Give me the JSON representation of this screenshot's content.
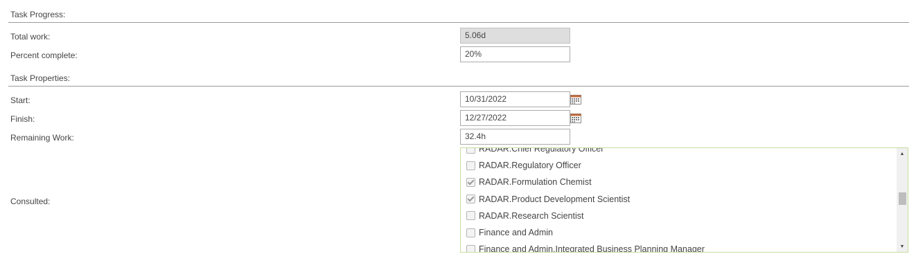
{
  "task_progress": {
    "title": "Task Progress:",
    "total_work": {
      "label": "Total work:",
      "value": "5.06d"
    },
    "percent_complete": {
      "label": "Percent complete:",
      "value": "20%"
    }
  },
  "task_properties": {
    "title": "Task Properties:",
    "start": {
      "label": "Start:",
      "value": "10/31/2022"
    },
    "finish": {
      "label": "Finish:",
      "value": "12/27/2022"
    },
    "remaining_work": {
      "label": "Remaining Work:",
      "value": "32.4h"
    },
    "consulted": {
      "label": "Consulted:",
      "options": [
        {
          "label": "RADAR.Chief Regulatory Officer",
          "checked": false
        },
        {
          "label": "RADAR.Regulatory Officer",
          "checked": false
        },
        {
          "label": "RADAR.Formulation Chemist",
          "checked": true
        },
        {
          "label": "RADAR.Product Development Scientist",
          "checked": true
        },
        {
          "label": "RADAR.Research Scientist",
          "checked": false
        },
        {
          "label": "Finance and Admin",
          "checked": false
        },
        {
          "label": "Finance and Admin.Integrated Business Planning Manager",
          "checked": false
        }
      ]
    }
  },
  "icons": {
    "date_picker": "calendar-icon",
    "scroll_up": "scroll-up-arrow-icon",
    "scroll_down": "scroll-down-arrow-icon"
  }
}
